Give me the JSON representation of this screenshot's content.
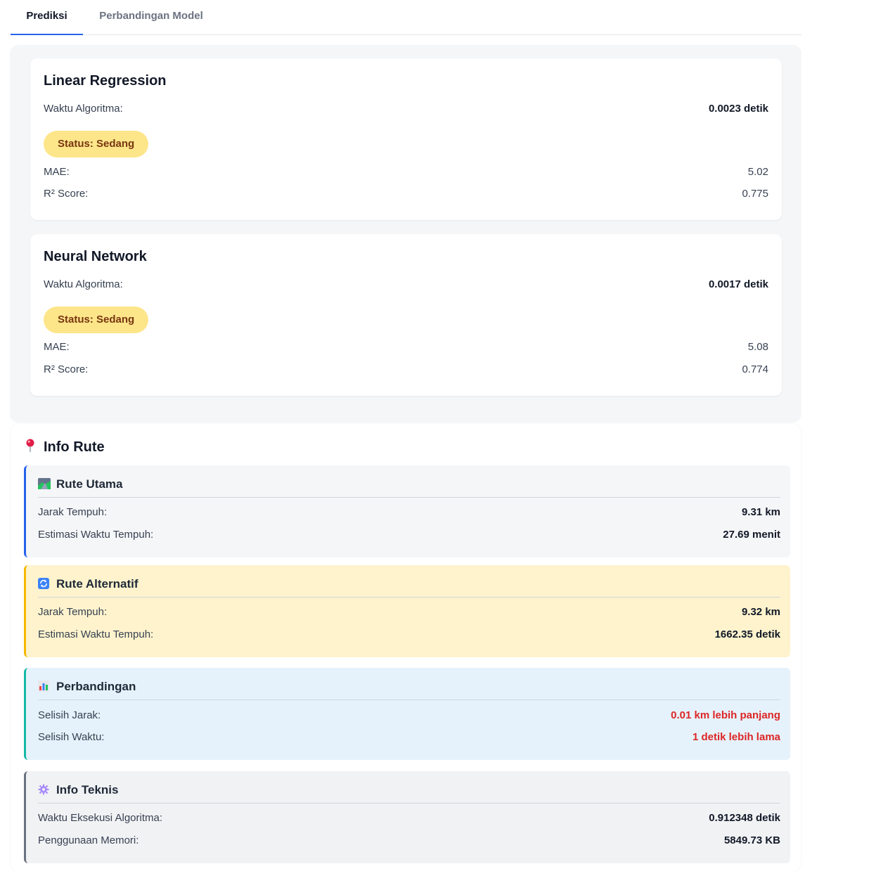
{
  "tabs": [
    "Prediksi",
    "Perbandingan Model"
  ],
  "models": [
    {
      "name": "Linear Regression",
      "time_label": "Waktu Algoritma:",
      "time_value": "0.0023 detik",
      "status": "Status:  Sedang",
      "mae_label": "MAE:",
      "mae_value": "5.02",
      "r2_label": "R² Score:",
      "r2_value": "0.775"
    },
    {
      "name": "Neural Network",
      "time_label": "Waktu Algoritma:",
      "time_value": "0.0017 detik",
      "status": "Status:  Sedang",
      "mae_label": "MAE:",
      "mae_value": "5.08",
      "r2_label": "R² Score:",
      "r2_value": "0.774"
    }
  ],
  "info": {
    "title": "Info Rute",
    "main_route": {
      "title": "Rute Utama",
      "distance_label": "Jarak Tempuh:",
      "distance_value": "9.31 km",
      "time_label": "Estimasi Waktu Tempuh:",
      "time_value": "27.69 menit"
    },
    "alt_route": {
      "title": "Rute Alternatif",
      "distance_label": "Jarak Tempuh:",
      "distance_value": "9.32 km",
      "time_label": "Estimasi Waktu Tempuh:",
      "time_value": "1662.35 detik"
    },
    "comparison": {
      "title": "Perbandingan",
      "distance_label": "Selisih Jarak:",
      "distance_value": "0.01 km lebih panjang",
      "time_label": "Selisih Waktu:",
      "time_value": "1 detik lebih lama"
    },
    "technical": {
      "title": "Info Teknis",
      "exec_label": "Waktu Eksekusi Algoritma:",
      "exec_value": "0.912348 detik",
      "mem_label": "Penggunaan Memori:",
      "mem_value": "5849.73 KB"
    }
  },
  "colors": {
    "accent_blue": "#2563eb",
    "warning_yellow": "#f5b700",
    "info_teal": "#14b8a6",
    "muted_gray": "#6b7280",
    "negative_red": "#dc2626",
    "status_bg": "#fde68a"
  },
  "icons": [
    "pin-icon",
    "map-icon",
    "refresh-icon",
    "bar-chart-icon",
    "gear-icon"
  ]
}
